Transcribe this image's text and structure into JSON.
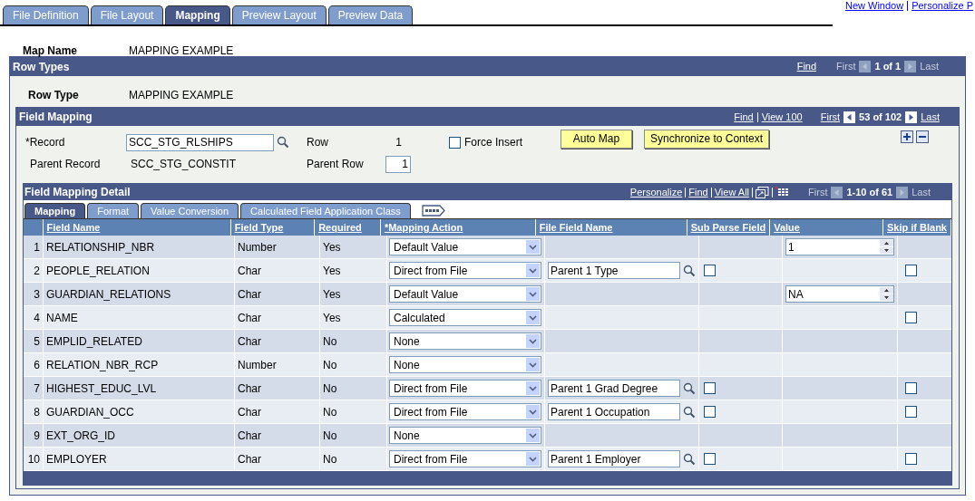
{
  "top_links": [
    "New Window",
    "Personalize P"
  ],
  "tabs": [
    {
      "label": "File Definition",
      "selected": false
    },
    {
      "label": "File Layout",
      "selected": false
    },
    {
      "label": "Mapping",
      "selected": true
    },
    {
      "label": "Preview Layout",
      "selected": false
    },
    {
      "label": "Preview Data",
      "selected": false
    }
  ],
  "map_name": {
    "label": "Map Name",
    "value": "MAPPING EXAMPLE"
  },
  "row_types": {
    "title": "Row Types",
    "find": "Find",
    "first": "First",
    "count": "1 of 1",
    "last": "Last",
    "row_type": {
      "label": "Row Type",
      "value": "MAPPING EXAMPLE"
    }
  },
  "field_mapping": {
    "title": "Field Mapping",
    "find": "Find",
    "view": "View 100",
    "first": "First",
    "count": "53 of 102",
    "last": "Last",
    "record": {
      "label": "*Record",
      "value": "SCC_STG_RLSHIPS"
    },
    "row": {
      "label": "Row",
      "value": "1"
    },
    "force_insert": {
      "label": "Force Insert",
      "checked": false
    },
    "buttons": [
      "Auto Map",
      "Synchronize to Context"
    ],
    "parent_record": {
      "label": "Parent Record",
      "value": "SCC_STG_CONSTIT"
    },
    "parent_row": {
      "label": "Parent Row",
      "value": "1"
    }
  },
  "detail": {
    "title": "Field Mapping Detail",
    "links": [
      "Personalize",
      "Find",
      "View All"
    ],
    "first": "First",
    "count": "1-10 of 61",
    "last": "Last",
    "tabs": [
      {
        "label": "Mapping",
        "selected": true
      },
      {
        "label": "Format",
        "selected": false
      },
      {
        "label": "Value Conversion",
        "selected": false
      },
      {
        "label": "Calculated Field Application Class",
        "selected": false
      }
    ],
    "columns": [
      "Field Name",
      "Field Type",
      "Required",
      "*Mapping Action",
      "File Field Name",
      "Sub Parse Field",
      "Value",
      "Skip if Blank"
    ],
    "rows": [
      {
        "num": "1",
        "field_name": "RELATIONSHIP_NBR",
        "field_type": "Number",
        "required": "Yes",
        "mapping_action": "Default Value",
        "value": "1"
      },
      {
        "num": "2",
        "field_name": "PEOPLE_RELATION",
        "field_type": "Char",
        "required": "Yes",
        "mapping_action": "Direct from File",
        "file_field_name": "Parent 1 Type",
        "sub_parse": {
          "checked": false
        },
        "skip_if_blank": {
          "checked": false
        }
      },
      {
        "num": "3",
        "field_name": "GUARDIAN_RELATIONS",
        "field_type": "Char",
        "required": "Yes",
        "mapping_action": "Default Value",
        "value": "NA"
      },
      {
        "num": "4",
        "field_name": "NAME",
        "field_type": "Char",
        "required": "Yes",
        "mapping_action": "Calculated",
        "skip_if_blank": {
          "checked": false
        }
      },
      {
        "num": "5",
        "field_name": "EMPLID_RELATED",
        "field_type": "Char",
        "required": "No",
        "mapping_action": "None"
      },
      {
        "num": "6",
        "field_name": "RELATION_NBR_RCP",
        "field_type": "Number",
        "required": "No",
        "mapping_action": "None"
      },
      {
        "num": "7",
        "field_name": "HIGHEST_EDUC_LVL",
        "field_type": "Char",
        "required": "No",
        "mapping_action": "Direct from File",
        "file_field_name": "Parent 1 Grad Degree",
        "sub_parse": {
          "checked": false
        },
        "skip_if_blank": {
          "checked": false
        }
      },
      {
        "num": "8",
        "field_name": "GUARDIAN_OCC",
        "field_type": "Char",
        "required": "No",
        "mapping_action": "Direct from File",
        "file_field_name": "Parent 1 Occupation",
        "sub_parse": {
          "checked": false
        },
        "skip_if_blank": {
          "checked": false
        }
      },
      {
        "num": "9",
        "field_name": "EXT_ORG_ID",
        "field_type": "Char",
        "required": "No",
        "mapping_action": "None"
      },
      {
        "num": "10",
        "field_name": "EMPLOYER",
        "field_type": "Char",
        "required": "No",
        "mapping_action": "Direct from File",
        "file_field_name": "Parent 1 Employer",
        "sub_parse": {
          "checked": false
        },
        "skip_if_blank": {
          "checked": false
        }
      }
    ]
  }
}
